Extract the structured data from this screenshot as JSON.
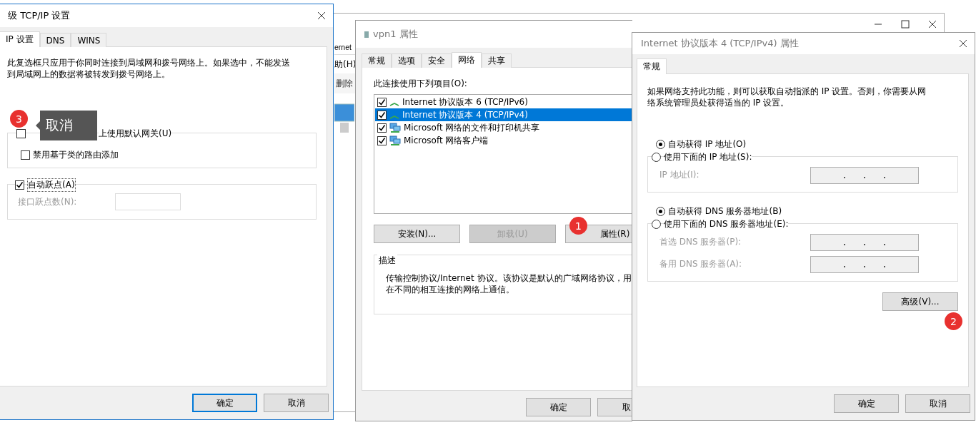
{
  "background_window": {
    "address_fragment": "ernet",
    "menu_fragment": "助(H)",
    "toolbar_fragment": "删除"
  },
  "advanced_dialog": {
    "title": "级 TCP/IP 设置",
    "tabs": [
      {
        "label": "IP 设置",
        "selected": true
      },
      {
        "label": "DNS",
        "selected": false
      },
      {
        "label": "WINS",
        "selected": false
      }
    ],
    "note_lines": [
      "此复选框只应用于你同时连接到局域网和拨号网络上。如果选中，不能发送",
      "到局域网上的数据将被转发到拨号网络上。"
    ],
    "gateway_options": [
      {
        "label": "上使用默认网关(U)",
        "checked": false
      },
      {
        "label": "禁用基于类的路由添加",
        "checked": false
      }
    ],
    "auto_metric": {
      "label": "自动跃点(A)",
      "checked": true
    },
    "metric_field": {
      "label": "接口跃点数(N):",
      "disabled": true
    },
    "buttons": [
      {
        "label": "确定",
        "default": true
      },
      {
        "label": "取消",
        "default": false
      }
    ]
  },
  "vpn_dialog": {
    "title": "vpn1 属性",
    "tabs": [
      {
        "label": "常规",
        "selected": false
      },
      {
        "label": "选项",
        "selected": false
      },
      {
        "label": "安全",
        "selected": false
      },
      {
        "label": "网络",
        "selected": true
      },
      {
        "label": "共享",
        "selected": false
      }
    ],
    "list_label": "此连接使用下列项目(O):",
    "items": [
      {
        "kind": "protocol",
        "label": "Internet 协议版本 6 (TCP/IPv6)",
        "checked": true,
        "selected": false
      },
      {
        "kind": "protocol",
        "label": "Internet 协议版本 4 (TCP/IPv4)",
        "checked": true,
        "selected": true
      },
      {
        "kind": "service",
        "label": "Microsoft 网络的文件和打印机共享",
        "checked": true,
        "selected": false
      },
      {
        "kind": "service",
        "label": "Microsoft 网络客户端",
        "checked": true,
        "selected": false
      }
    ],
    "actions": [
      {
        "label": "安装(N)...",
        "disabled": false
      },
      {
        "label": "卸载(U)",
        "disabled": true
      },
      {
        "label": "属性(R)",
        "disabled": false
      }
    ],
    "description_title": "描述",
    "description_lines": [
      "传输控制协议/Internet 协议。该协议是默认的广域网络协议，用",
      "在不同的相互连接的网络上通信。"
    ],
    "buttons": [
      {
        "label": "确定",
        "default": false
      },
      {
        "label": "取",
        "default": false
      }
    ]
  },
  "ipv4_dialog": {
    "title": "Internet 协议版本 4 (TCP/IPv4) 属性",
    "tabs": [
      {
        "label": "常规",
        "selected": true
      }
    ],
    "intro_lines": [
      "如果网络支持此功能，则可以获取自动指派的 IP 设置。否则，你需要从网",
      "络系统管理员处获得适当的 IP 设置。"
    ],
    "ip_options": [
      {
        "label": "自动获得 IP 地址(O)",
        "selected": true
      },
      {
        "label": "使用下面的 IP 地址(S):",
        "selected": false
      }
    ],
    "ip_fields": [
      {
        "label": "IP 地址(I):",
        "disabled": true
      }
    ],
    "dns_options": [
      {
        "label": "自动获得 DNS 服务器地址(B)",
        "selected": true
      },
      {
        "label": "使用下面的 DNS 服务器地址(E):",
        "selected": false
      }
    ],
    "dns_fields": [
      {
        "label": "首选 DNS 服务器(P):",
        "disabled": true
      },
      {
        "label": "备用 DNS 服务器(A):",
        "disabled": true
      }
    ],
    "advanced_button": "高级(V)...",
    "buttons": [
      {
        "label": "确定",
        "default": false
      },
      {
        "label": "取消",
        "default": false
      }
    ]
  },
  "annotations": [
    {
      "number": "1"
    },
    {
      "number": "2"
    },
    {
      "number": "3"
    }
  ],
  "tooltip": "取消"
}
